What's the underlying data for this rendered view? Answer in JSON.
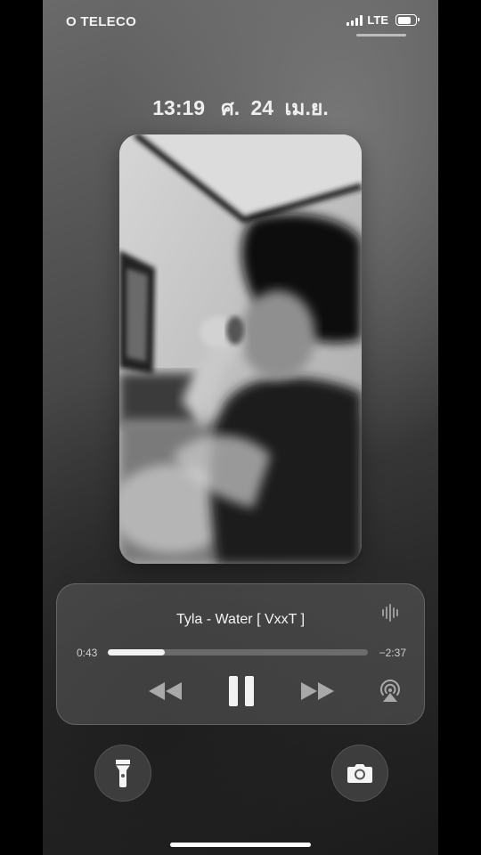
{
  "status_bar": {
    "carrier": "O TELECO",
    "network": "LTE",
    "signal_bars": 4,
    "battery_level": 0.8
  },
  "lockscreen": {
    "time": "13:19",
    "date": "ศ. 24 เม.ย."
  },
  "media_player": {
    "title": "Tyla - Water  [ VxxT ]",
    "elapsed": "0:43",
    "remaining": "−2:37",
    "progress": 0.22,
    "state": "playing",
    "icons": {
      "waveform": "waveform-icon",
      "rewind": "rewind-icon",
      "pause": "pause-icon",
      "forward": "fast-forward-icon",
      "airplay": "airplay-icon"
    }
  },
  "quick_actions": {
    "left": "flashlight-icon",
    "right": "camera-icon"
  },
  "colors": {
    "text": "#ffffff",
    "progress_fill": "#f1f1f1",
    "controls_dim": "#a9a9a9"
  }
}
